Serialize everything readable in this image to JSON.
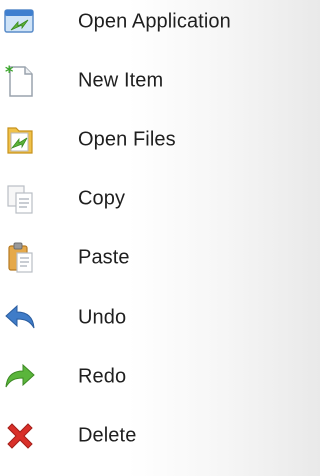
{
  "menu": {
    "items": [
      {
        "label": "Open Application",
        "icon": "open-application-icon"
      },
      {
        "label": "New Item",
        "icon": "new-item-icon"
      },
      {
        "label": "Open Files",
        "icon": "open-files-icon"
      },
      {
        "label": "Copy",
        "icon": "copy-icon"
      },
      {
        "label": "Paste",
        "icon": "paste-icon"
      },
      {
        "label": "Undo",
        "icon": "undo-icon"
      },
      {
        "label": "Redo",
        "icon": "redo-icon"
      },
      {
        "label": "Delete",
        "icon": "delete-icon"
      }
    ]
  }
}
